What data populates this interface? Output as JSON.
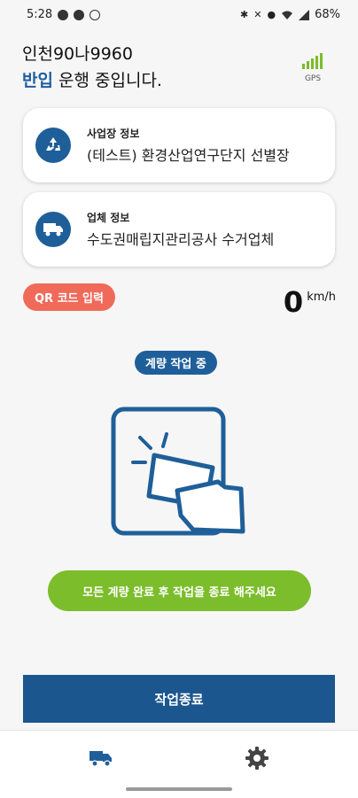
{
  "status_bar": {
    "time": "5:28",
    "battery": "68%"
  },
  "vehicle": {
    "plate": "인천90나9960",
    "operation_highlight": "반입",
    "operation_rest": "운행 중입니다."
  },
  "gps": {
    "label": "GPS",
    "signal_color": "#7bbd2a"
  },
  "site_card": {
    "title": "사업장 정보",
    "value": "(테스트) 환경산업연구단지 선별장",
    "icon": "recycle-icon"
  },
  "company_card": {
    "title": "업체 정보",
    "value": "수도권매립지관리공사 수거업체",
    "icon": "truck-icon"
  },
  "qr_button": {
    "label": "QR 코드 입력",
    "color": "#f06a5a"
  },
  "speed": {
    "value": "0",
    "unit": "km/h"
  },
  "work_status": {
    "label": "계량 작업 중",
    "color": "#1f5f99"
  },
  "hint": {
    "label": "모든 계량 완료 후 작업을 종료 해주세요",
    "color": "#7bbd2a"
  },
  "end_button": {
    "label": "작업종료",
    "color": "#1c568e"
  },
  "bottom_nav": {
    "items": [
      {
        "icon": "truck-icon",
        "active": true
      },
      {
        "icon": "gear-icon",
        "active": false
      }
    ]
  }
}
